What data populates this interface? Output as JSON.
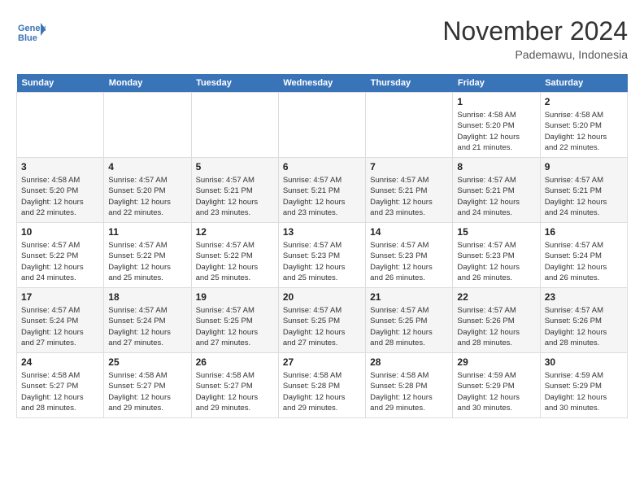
{
  "header": {
    "logo_line1": "General",
    "logo_line2": "Blue",
    "month_title": "November 2024",
    "location": "Pademawu, Indonesia"
  },
  "weekdays": [
    "Sunday",
    "Monday",
    "Tuesday",
    "Wednesday",
    "Thursday",
    "Friday",
    "Saturday"
  ],
  "weeks": [
    [
      {
        "day": "",
        "info": ""
      },
      {
        "day": "",
        "info": ""
      },
      {
        "day": "",
        "info": ""
      },
      {
        "day": "",
        "info": ""
      },
      {
        "day": "",
        "info": ""
      },
      {
        "day": "1",
        "info": "Sunrise: 4:58 AM\nSunset: 5:20 PM\nDaylight: 12 hours\nand 21 minutes."
      },
      {
        "day": "2",
        "info": "Sunrise: 4:58 AM\nSunset: 5:20 PM\nDaylight: 12 hours\nand 22 minutes."
      }
    ],
    [
      {
        "day": "3",
        "info": "Sunrise: 4:58 AM\nSunset: 5:20 PM\nDaylight: 12 hours\nand 22 minutes."
      },
      {
        "day": "4",
        "info": "Sunrise: 4:57 AM\nSunset: 5:20 PM\nDaylight: 12 hours\nand 22 minutes."
      },
      {
        "day": "5",
        "info": "Sunrise: 4:57 AM\nSunset: 5:21 PM\nDaylight: 12 hours\nand 23 minutes."
      },
      {
        "day": "6",
        "info": "Sunrise: 4:57 AM\nSunset: 5:21 PM\nDaylight: 12 hours\nand 23 minutes."
      },
      {
        "day": "7",
        "info": "Sunrise: 4:57 AM\nSunset: 5:21 PM\nDaylight: 12 hours\nand 23 minutes."
      },
      {
        "day": "8",
        "info": "Sunrise: 4:57 AM\nSunset: 5:21 PM\nDaylight: 12 hours\nand 24 minutes."
      },
      {
        "day": "9",
        "info": "Sunrise: 4:57 AM\nSunset: 5:21 PM\nDaylight: 12 hours\nand 24 minutes."
      }
    ],
    [
      {
        "day": "10",
        "info": "Sunrise: 4:57 AM\nSunset: 5:22 PM\nDaylight: 12 hours\nand 24 minutes."
      },
      {
        "day": "11",
        "info": "Sunrise: 4:57 AM\nSunset: 5:22 PM\nDaylight: 12 hours\nand 25 minutes."
      },
      {
        "day": "12",
        "info": "Sunrise: 4:57 AM\nSunset: 5:22 PM\nDaylight: 12 hours\nand 25 minutes."
      },
      {
        "day": "13",
        "info": "Sunrise: 4:57 AM\nSunset: 5:23 PM\nDaylight: 12 hours\nand 25 minutes."
      },
      {
        "day": "14",
        "info": "Sunrise: 4:57 AM\nSunset: 5:23 PM\nDaylight: 12 hours\nand 26 minutes."
      },
      {
        "day": "15",
        "info": "Sunrise: 4:57 AM\nSunset: 5:23 PM\nDaylight: 12 hours\nand 26 minutes."
      },
      {
        "day": "16",
        "info": "Sunrise: 4:57 AM\nSunset: 5:24 PM\nDaylight: 12 hours\nand 26 minutes."
      }
    ],
    [
      {
        "day": "17",
        "info": "Sunrise: 4:57 AM\nSunset: 5:24 PM\nDaylight: 12 hours\nand 27 minutes."
      },
      {
        "day": "18",
        "info": "Sunrise: 4:57 AM\nSunset: 5:24 PM\nDaylight: 12 hours\nand 27 minutes."
      },
      {
        "day": "19",
        "info": "Sunrise: 4:57 AM\nSunset: 5:25 PM\nDaylight: 12 hours\nand 27 minutes."
      },
      {
        "day": "20",
        "info": "Sunrise: 4:57 AM\nSunset: 5:25 PM\nDaylight: 12 hours\nand 27 minutes."
      },
      {
        "day": "21",
        "info": "Sunrise: 4:57 AM\nSunset: 5:25 PM\nDaylight: 12 hours\nand 28 minutes."
      },
      {
        "day": "22",
        "info": "Sunrise: 4:57 AM\nSunset: 5:26 PM\nDaylight: 12 hours\nand 28 minutes."
      },
      {
        "day": "23",
        "info": "Sunrise: 4:57 AM\nSunset: 5:26 PM\nDaylight: 12 hours\nand 28 minutes."
      }
    ],
    [
      {
        "day": "24",
        "info": "Sunrise: 4:58 AM\nSunset: 5:27 PM\nDaylight: 12 hours\nand 28 minutes."
      },
      {
        "day": "25",
        "info": "Sunrise: 4:58 AM\nSunset: 5:27 PM\nDaylight: 12 hours\nand 29 minutes."
      },
      {
        "day": "26",
        "info": "Sunrise: 4:58 AM\nSunset: 5:27 PM\nDaylight: 12 hours\nand 29 minutes."
      },
      {
        "day": "27",
        "info": "Sunrise: 4:58 AM\nSunset: 5:28 PM\nDaylight: 12 hours\nand 29 minutes."
      },
      {
        "day": "28",
        "info": "Sunrise: 4:58 AM\nSunset: 5:28 PM\nDaylight: 12 hours\nand 29 minutes."
      },
      {
        "day": "29",
        "info": "Sunrise: 4:59 AM\nSunset: 5:29 PM\nDaylight: 12 hours\nand 30 minutes."
      },
      {
        "day": "30",
        "info": "Sunrise: 4:59 AM\nSunset: 5:29 PM\nDaylight: 12 hours\nand 30 minutes."
      }
    ]
  ]
}
